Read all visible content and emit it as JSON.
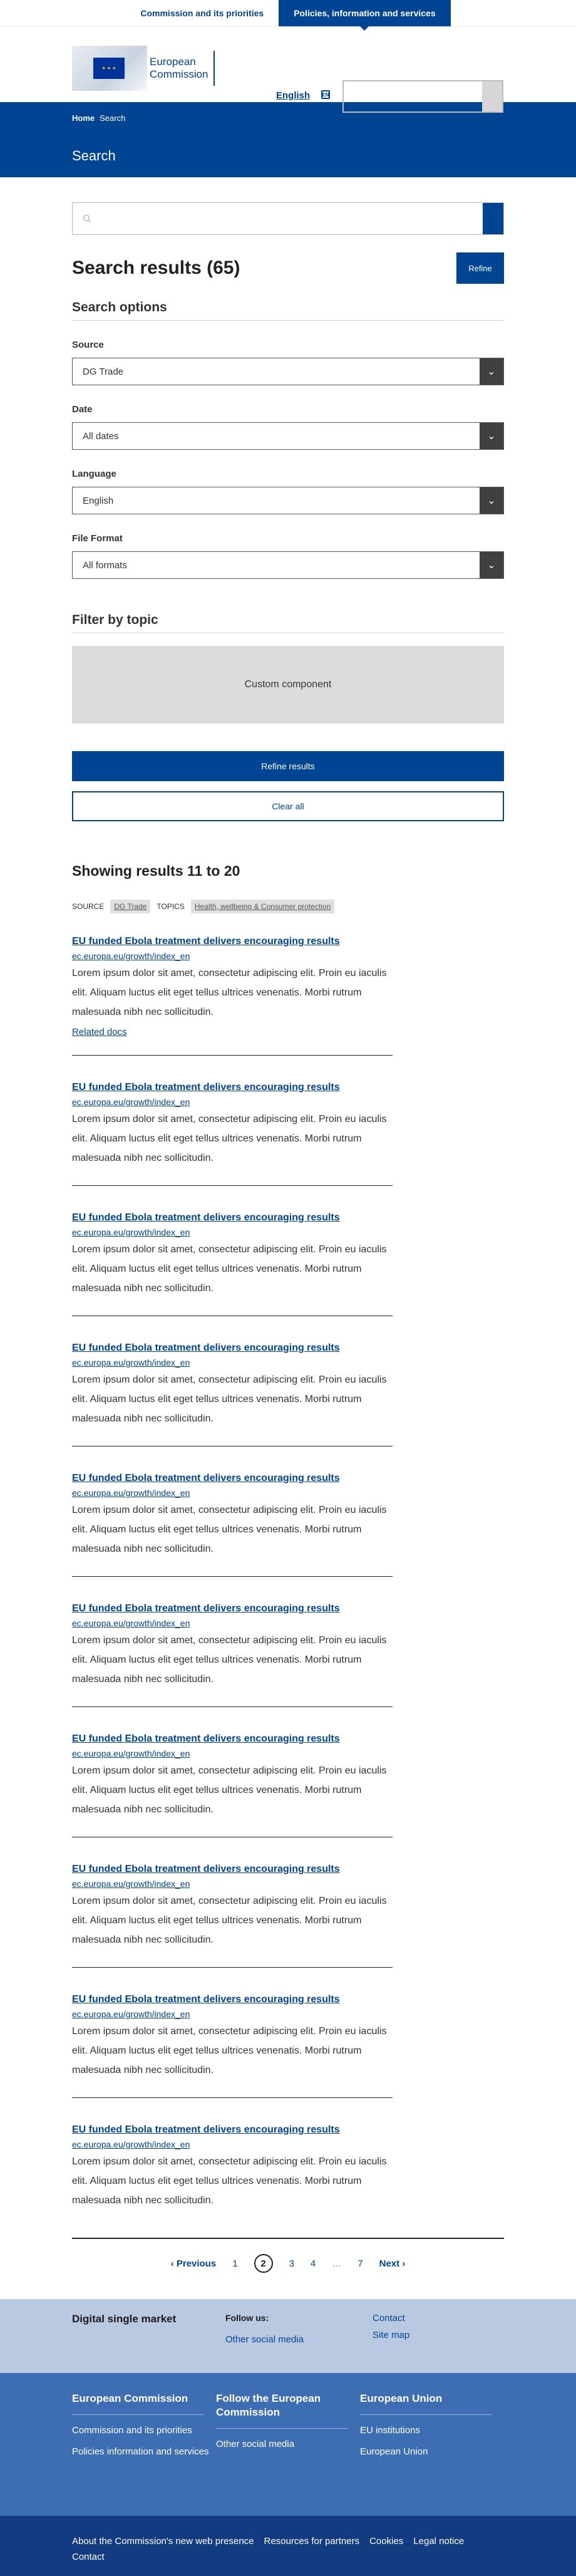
{
  "topnav": {
    "tab1": "Commission and its priorities",
    "tab2": "Policies, information and services"
  },
  "header": {
    "logo_line1": "European",
    "logo_line2": "Commission",
    "language": "English",
    "lang_icon": "EN"
  },
  "breadcrumb": {
    "home": "Home",
    "current": "Search"
  },
  "page": {
    "title": "Search"
  },
  "search": {
    "placeholder": ""
  },
  "results_header": {
    "title": "Search results (65)",
    "refine_label": "Refine"
  },
  "search_options": {
    "title": "Search options",
    "source": {
      "label": "Source",
      "value": "DG Trade"
    },
    "date": {
      "label": "Date",
      "value": "All dates"
    },
    "language": {
      "label": "Language",
      "value": "English"
    },
    "format": {
      "label": "File Format",
      "value": "All formats"
    }
  },
  "filter": {
    "title": "Filter by topic",
    "custom": "Custom component"
  },
  "actions": {
    "refine_results": "Refine results",
    "clear_all": "Clear all"
  },
  "showing": "Showing results 11 to 20",
  "active_filters": {
    "source_label": "SOURCE",
    "source_value": "DG Trade",
    "topics_label": "TOPICS",
    "topics_value": "Health, wellbeing & Consumer protection"
  },
  "results": [
    {
      "title": "EU funded Ebola treatment delivers encouraging results",
      "url": "ec.europa.eu/growth/index_en",
      "desc": "Lorem ipsum dolor sit amet, consectetur adipiscing elit. Proin eu iaculis elit. Aliquam luctus elit eget tellus ultrices venenatis. Morbi rutrum malesuada nibh nec sollicitudin.",
      "related": "Related docs"
    },
    {
      "title": "EU funded Ebola treatment delivers encouraging results",
      "url": "ec.europa.eu/growth/index_en",
      "desc": "Lorem ipsum dolor sit amet, consectetur adipiscing elit. Proin eu iaculis elit. Aliquam luctus elit eget tellus ultrices venenatis. Morbi rutrum malesuada nibh nec sollicitudin."
    },
    {
      "title": "EU funded Ebola treatment delivers encouraging results",
      "url": "ec.europa.eu/growth/index_en",
      "desc": "Lorem ipsum dolor sit amet, consectetur adipiscing elit. Proin eu iaculis elit. Aliquam luctus elit eget tellus ultrices venenatis. Morbi rutrum malesuada nibh nec sollicitudin."
    },
    {
      "title": "EU funded Ebola treatment delivers encouraging results",
      "url": "ec.europa.eu/growth/index_en",
      "desc": "Lorem ipsum dolor sit amet, consectetur adipiscing elit. Proin eu iaculis elit. Aliquam luctus elit eget tellus ultrices venenatis. Morbi rutrum malesuada nibh nec sollicitudin."
    },
    {
      "title": "EU funded Ebola treatment delivers encouraging results",
      "url": "ec.europa.eu/growth/index_en",
      "desc": "Lorem ipsum dolor sit amet, consectetur adipiscing elit. Proin eu iaculis elit. Aliquam luctus elit eget tellus ultrices venenatis. Morbi rutrum malesuada nibh nec sollicitudin."
    },
    {
      "title": "EU funded Ebola treatment delivers encouraging results",
      "url": "ec.europa.eu/growth/index_en",
      "desc": "Lorem ipsum dolor sit amet, consectetur adipiscing elit. Proin eu iaculis elit. Aliquam luctus elit eget tellus ultrices venenatis. Morbi rutrum malesuada nibh nec sollicitudin."
    },
    {
      "title": "EU funded Ebola treatment delivers encouraging results",
      "url": "ec.europa.eu/growth/index_en",
      "desc": "Lorem ipsum dolor sit amet, consectetur adipiscing elit. Proin eu iaculis elit. Aliquam luctus elit eget tellus ultrices venenatis. Morbi rutrum malesuada nibh nec sollicitudin."
    },
    {
      "title": "EU funded Ebola treatment delivers encouraging results",
      "url": "ec.europa.eu/growth/index_en",
      "desc": "Lorem ipsum dolor sit amet, consectetur adipiscing elit. Proin eu iaculis elit. Aliquam luctus elit eget tellus ultrices venenatis. Morbi rutrum malesuada nibh nec sollicitudin."
    },
    {
      "title": "EU funded Ebola treatment delivers encouraging results",
      "url": "ec.europa.eu/growth/index_en",
      "desc": "Lorem ipsum dolor sit amet, consectetur adipiscing elit. Proin eu iaculis elit. Aliquam luctus elit eget tellus ultrices venenatis. Morbi rutrum malesuada nibh nec sollicitudin."
    },
    {
      "title": "EU funded Ebola treatment delivers encouraging results",
      "url": "ec.europa.eu/growth/index_en",
      "desc": "Lorem ipsum dolor sit amet, consectetur adipiscing elit. Proin eu iaculis elit. Aliquam luctus elit eget tellus ultrices venenatis. Morbi rutrum malesuada nibh nec sollicitudin."
    }
  ],
  "pagination": {
    "prev": "‹ Previous",
    "p1": "1",
    "p2": "2",
    "p3": "3",
    "p4": "4",
    "ellipsis": "…",
    "p7": "7",
    "next": "Next ›"
  },
  "footer_top": {
    "title": "Digital single market",
    "follow_label": "Follow us:",
    "social": "Other social media",
    "contact": "Contact",
    "sitemap": "Site map"
  },
  "footer_mid": {
    "col1": {
      "title": "European Commission",
      "link1": "Commission and its priorities",
      "link2": "Policies information and services"
    },
    "col2": {
      "title": "Follow the European Commission",
      "link1": "Other social media"
    },
    "col3": {
      "title": "European Union",
      "link1": "EU institutions",
      "link2": "European Union"
    }
  },
  "footer_bottom": {
    "link1": "About the Commission's new web presence",
    "link2": "Resources for partners",
    "link3": "Cookies",
    "link4": "Legal notice",
    "contact": "Contact"
  }
}
